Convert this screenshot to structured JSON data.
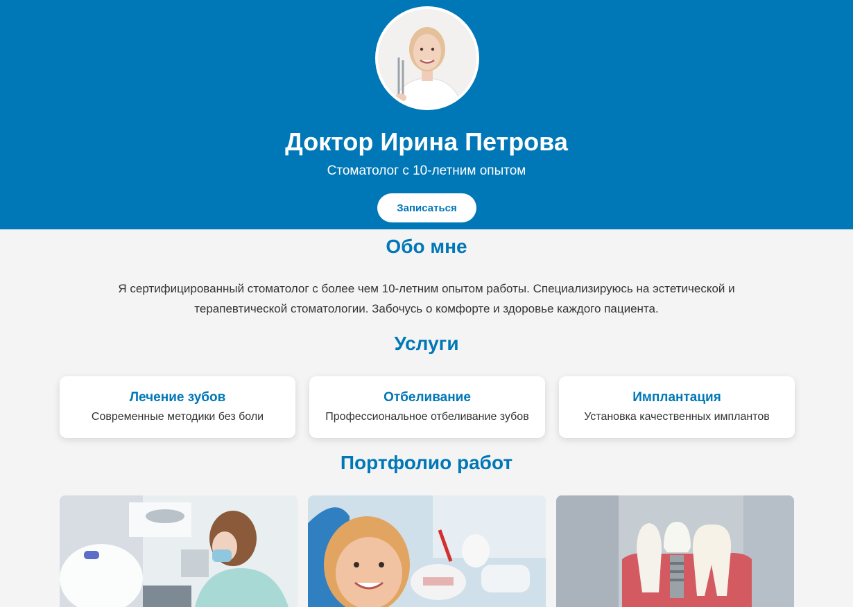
{
  "hero": {
    "name": "Доктор Ирина Петрова",
    "subtitle": "Стоматолог с 10-летним опытом",
    "cta_label": "Записаться"
  },
  "about": {
    "title": "Обо мне",
    "text": "Я сертифицированный стоматолог с более чем 10-летним опытом работы. Специализируюсь на эстетической и терапевтической стоматологии. Забочусь о комфорте и здоровье каждого пациента."
  },
  "services": {
    "title": "Услуги",
    "items": [
      {
        "title": "Лечение зубов",
        "desc": "Современные методики без боли"
      },
      {
        "title": "Отбеливание",
        "desc": "Профессиональное отбеливание зубов"
      },
      {
        "title": "Имплантация",
        "desc": "Установка качественных имплантов"
      }
    ]
  },
  "portfolio": {
    "title": "Портфолио работ"
  },
  "colors": {
    "brand": "#0077b6",
    "background": "#f4f4f4"
  }
}
